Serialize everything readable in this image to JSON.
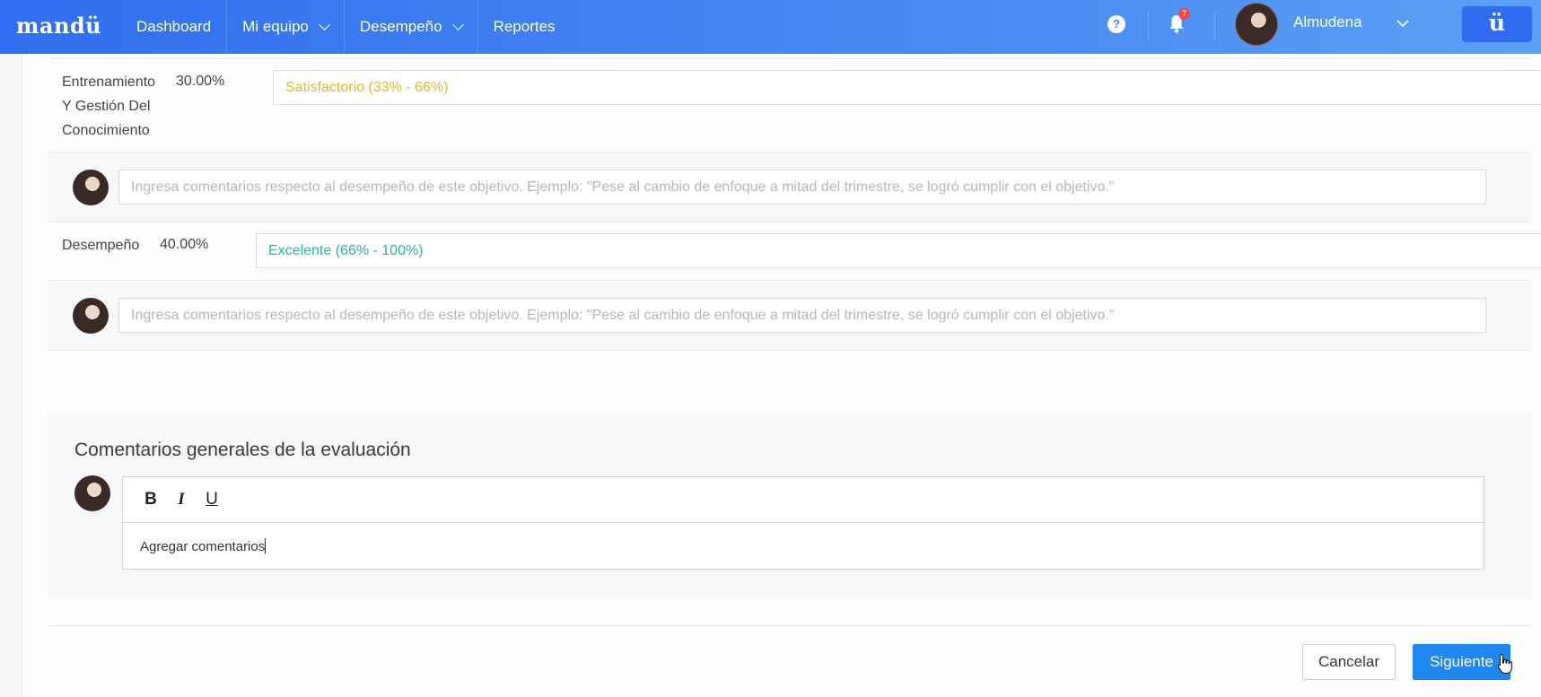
{
  "app": {
    "logo": "mandü",
    "app_button": "ü"
  },
  "nav": [
    {
      "label": "Dashboard",
      "dropdown": false
    },
    {
      "label": "Mi equipo",
      "dropdown": true
    },
    {
      "label": "Desempeño",
      "dropdown": true
    },
    {
      "label": "Reportes",
      "dropdown": false
    }
  ],
  "header": {
    "help": "?",
    "notifications_count": "7",
    "user_name": "Almudena"
  },
  "objectives": [
    {
      "name": "Entrenamiento Y Gestión Del Conocimiento",
      "name_lines": [
        "Entrenamiento",
        "Y Gestión Del",
        "Conocimiento"
      ],
      "weight": "30.00%",
      "rating": "Satisfactorio (33% - 66%)",
      "rating_color": "#e8b622"
    },
    {
      "name": "Desempeño",
      "name_lines": [
        "Desempeño"
      ],
      "weight": "40.00%",
      "rating": "Excelente (66% - 100%)",
      "rating_color": "#1fb89b"
    }
  ],
  "comment_placeholder": "Ingresa comentarios respecto al desempeño de este objetivo. Ejemplo: \"Pese al cambio de enfoque a mitad del trimestre, se logró cumplir con el objetivo.\"",
  "general": {
    "title": "Comentarios generales de la evaluación",
    "toolbar": {
      "bold": "B",
      "italic": "I",
      "underline": "U"
    },
    "text": "Agregar comentarios"
  },
  "actions": {
    "cancel": "Cancelar",
    "next": "Siguiente"
  },
  "colors": {
    "nav_start": "#2f6ff0",
    "nav_end": "#5aa0f4",
    "primary_button": "#1e88f0",
    "badge": "#f04a4a"
  }
}
